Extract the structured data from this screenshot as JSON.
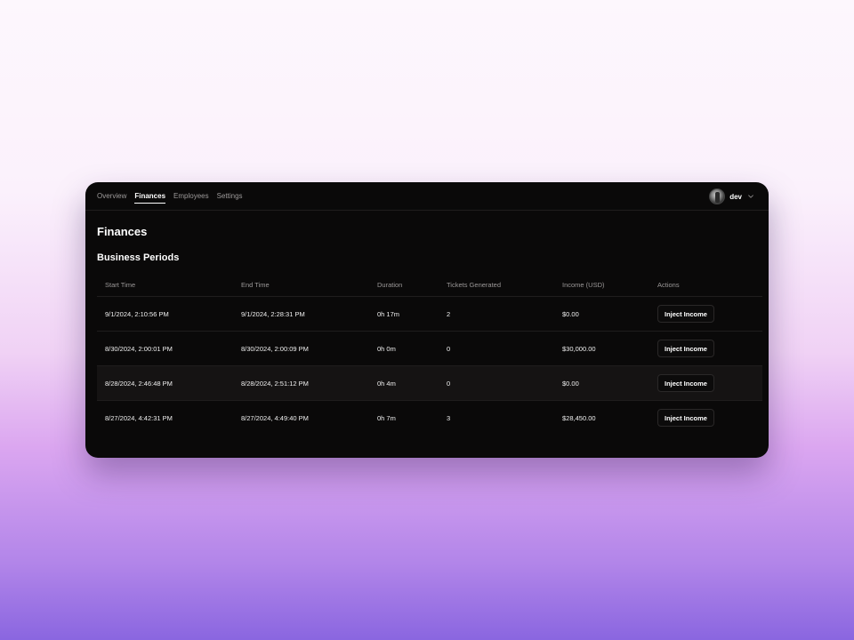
{
  "nav": {
    "items": [
      {
        "label": "Overview",
        "active": false
      },
      {
        "label": "Finances",
        "active": true
      },
      {
        "label": "Employees",
        "active": false
      },
      {
        "label": "Settings",
        "active": false
      }
    ]
  },
  "user": {
    "name": "dev"
  },
  "page": {
    "title": "Finances",
    "section_title": "Business Periods"
  },
  "table": {
    "columns": [
      "Start Time",
      "End Time",
      "Duration",
      "Tickets Generated",
      "Income (USD)",
      "Actions"
    ],
    "rows": [
      {
        "start": "9/1/2024, 2:10:56 PM",
        "end": "9/1/2024, 2:28:31 PM",
        "duration": "0h 17m",
        "tickets": "2",
        "income": "$0.00",
        "action": "Inject Income"
      },
      {
        "start": "8/30/2024, 2:00:01 PM",
        "end": "8/30/2024, 2:00:09 PM",
        "duration": "0h 0m",
        "tickets": "0",
        "income": "$30,000.00",
        "action": "Inject Income"
      },
      {
        "start": "8/28/2024, 2:46:48 PM",
        "end": "8/28/2024, 2:51:12 PM",
        "duration": "0h 4m",
        "tickets": "0",
        "income": "$0.00",
        "action": "Inject Income"
      },
      {
        "start": "8/27/2024, 4:42:31 PM",
        "end": "8/27/2024, 4:49:40 PM",
        "duration": "0h 7m",
        "tickets": "3",
        "income": "$28,450.00",
        "action": "Inject Income"
      }
    ]
  },
  "icons": {
    "user_menu": "chevron-down-icon",
    "avatar": "avatar"
  },
  "colors": {
    "window_bg": "#0a0909",
    "text_primary": "#ffffff",
    "text_muted": "#9b9898",
    "row_highlight": "#151313"
  }
}
